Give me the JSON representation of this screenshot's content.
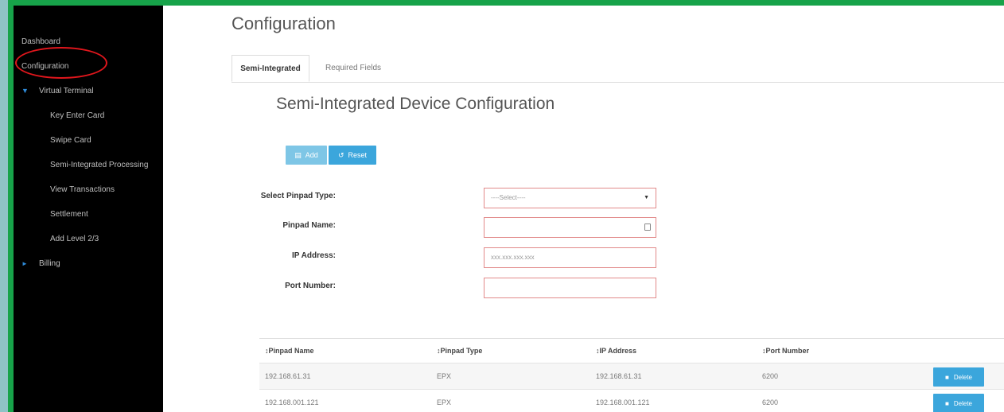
{
  "sidebar": {
    "items": [
      {
        "label": "Dashboard"
      },
      {
        "label": "Configuration"
      },
      {
        "label": "Virtual Terminal"
      },
      {
        "label": "Key Enter Card"
      },
      {
        "label": "Swipe Card"
      },
      {
        "label": "Semi-Integrated Processing"
      },
      {
        "label": "View Transactions"
      },
      {
        "label": "Settlement"
      },
      {
        "label": "Add Level 2/3"
      },
      {
        "label": "Billing"
      }
    ],
    "highlight_color": "#e0161c",
    "arrow_color": "#2e8ad8"
  },
  "page": {
    "title": "Configuration"
  },
  "tabs": [
    {
      "label": "Semi-Integrated",
      "active": true
    },
    {
      "label": "Required Fields",
      "active": false
    }
  ],
  "section": {
    "title": "Semi-Integrated Device Configuration"
  },
  "toolbar": {
    "add_label": "Add",
    "reset_label": "Reset"
  },
  "form": {
    "pinpad_type": {
      "label": "Select Pinpad Type:",
      "value": "----Select----"
    },
    "pinpad_name": {
      "label": "Pinpad Name:",
      "value": ""
    },
    "ip_address": {
      "label": "IP Address:",
      "placeholder": "xxx.xxx.xxx.xxx"
    },
    "port_number": {
      "label": "Port Number:",
      "value": ""
    }
  },
  "table": {
    "headers": [
      "↕Pinpad Name",
      "↕Pinpad Type",
      "↕IP Address",
      "↕Port Number"
    ],
    "rows": [
      {
        "name": "192.168.61.31",
        "type": "EPX",
        "ip": "192.168.61.31",
        "port": "6200",
        "action": "Delete"
      },
      {
        "name": "192.168.001.121",
        "type": "EPX",
        "ip": "192.168.001.121",
        "port": "6200",
        "action": "Delete"
      }
    ]
  },
  "colors": {
    "frame": "#17a34a",
    "button": "#3ba6dc",
    "error_border": "#e28b8b"
  }
}
